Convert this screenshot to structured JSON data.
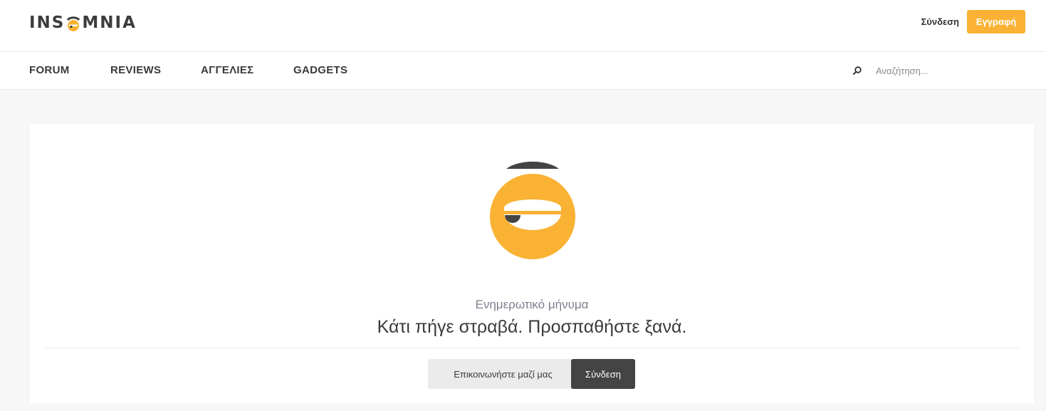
{
  "header": {
    "logo_text_left": "INS",
    "logo_text_right": "MNIA",
    "login_label": "Σύνδεση",
    "register_label": "Εγγραφή",
    "accent_color": "#f9b233"
  },
  "nav": {
    "items": [
      {
        "label": "FORUM"
      },
      {
        "label": "REVIEWS"
      },
      {
        "label": "ΑΓΓΕΛΙΕΣ"
      },
      {
        "label": "GADGETS"
      }
    ],
    "search": {
      "icon": "search-icon",
      "placeholder": "Αναζήτηση..."
    }
  },
  "error": {
    "mascot_icon": "sleepy-face-icon",
    "subtitle": "Ενημερωτικό μήνυμα",
    "message": "Κάτι πήγε στραβά. Προσπαθήστε ξανά.",
    "contact_button": "Επικοινωνήστε μαζί μας",
    "login_button": "Σύνδεση"
  }
}
